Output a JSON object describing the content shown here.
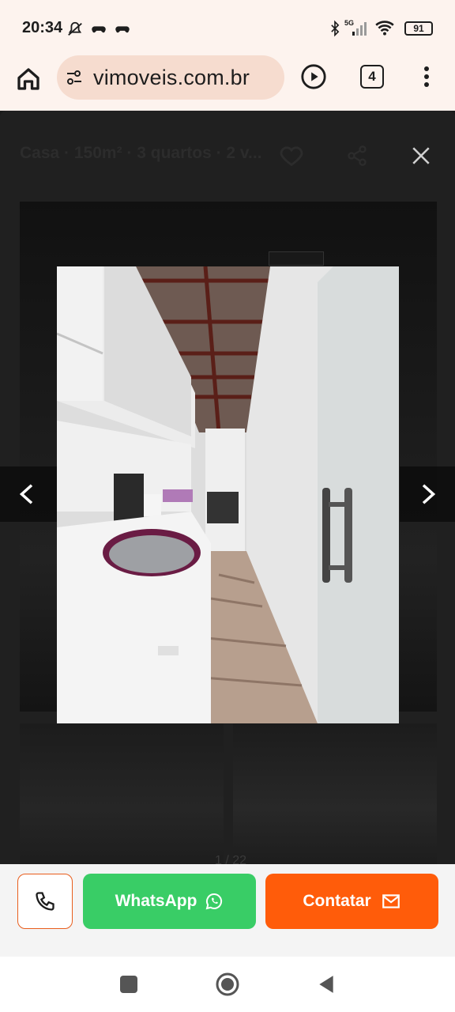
{
  "status_bar": {
    "time": "20:34",
    "battery": "91",
    "network": "5G",
    "icons_left": [
      "mute-icon",
      "gamepad-icon",
      "gamepad-icon"
    ],
    "icons_right": [
      "bluetooth-icon",
      "signal-icon",
      "wifi-icon",
      "battery-icon"
    ]
  },
  "browser": {
    "url": "vimoveis.com.br",
    "tab_count": "4",
    "icons": [
      "home-icon",
      "site-settings-icon",
      "play-icon",
      "tabs-icon",
      "more-vert-icon"
    ]
  },
  "gallery": {
    "title": "Casa · 150m² · 3 quartos · 2 v...",
    "counter": "1 / 22",
    "icons": [
      "heart-icon",
      "share-icon",
      "close-icon",
      "chevron-left-icon",
      "chevron-right-icon"
    ],
    "photo_description_colors": {
      "wall": "#e9e9e9",
      "floor": "#b89e8c",
      "roof": "#6b2e25"
    }
  },
  "actions": {
    "call_icon": "phone-icon",
    "whatsapp_label": "WhatsApp",
    "whatsapp_icon": "whatsapp-icon",
    "contact_label": "Contatar",
    "contact_icon": "mail-icon",
    "colors": {
      "whatsapp": "#39cd66",
      "contact": "#ff5c0a"
    }
  },
  "nav_bar": {
    "icons": [
      "recents-icon",
      "home-nav-icon",
      "back-icon"
    ]
  }
}
